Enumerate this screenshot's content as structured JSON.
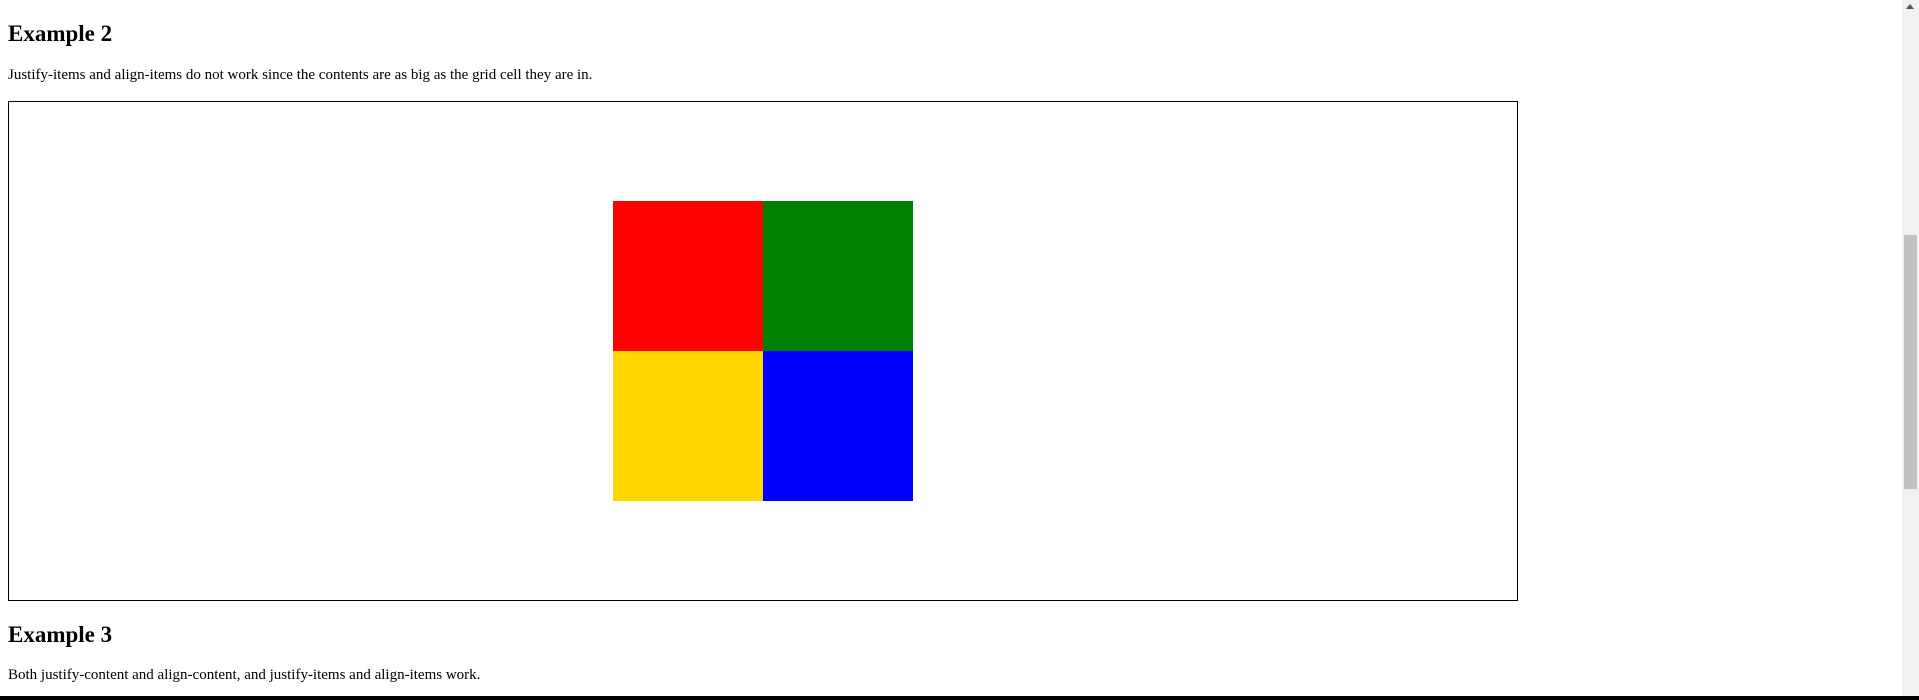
{
  "example2": {
    "heading": "Example 2",
    "description": "Justify-items and align-items do not work since the contents are as big as the grid cell they are in."
  },
  "grid": {
    "cells": [
      {
        "name": "red-cell",
        "color": "#ff0000"
      },
      {
        "name": "green-cell",
        "color": "#008000"
      },
      {
        "name": "yellow-cell",
        "color": "#ffd700"
      },
      {
        "name": "blue-cell",
        "color": "#0000ff"
      }
    ]
  },
  "example3": {
    "heading": "Example 3",
    "description": "Both justify-content and align-content, and justify-items and align-items work."
  }
}
